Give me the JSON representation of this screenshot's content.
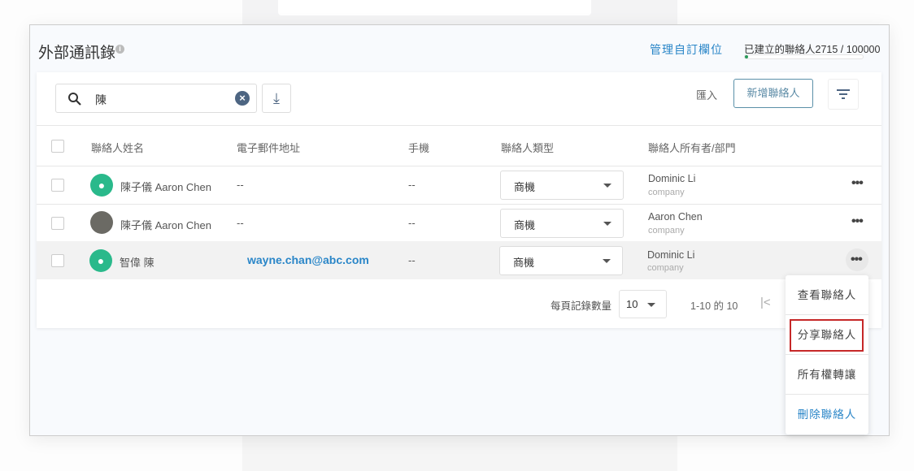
{
  "header": {
    "title": "外部通訊錄",
    "info_icon": "i",
    "manage_fields": "管理自訂欄位",
    "quota_label": "已建立的聯絡人2715 / 100000",
    "quota_fraction": 0.027
  },
  "toolbar": {
    "search_value": "陳",
    "clear": "×",
    "download": "⤓",
    "import": "匯入",
    "add_contact": "新增聯絡人"
  },
  "table": {
    "columns": [
      "聯絡人姓名",
      "電子郵件地址",
      "手機",
      "聯絡人類型",
      "聯絡人所有者/部門"
    ],
    "rows": [
      {
        "name": "陳子儀 Aaron Chen",
        "email": "--",
        "mobile": "--",
        "type": "商機",
        "owner": "Dominic Li",
        "dept": "company"
      },
      {
        "name": "陳子儀 Aaron Chen",
        "email": "--",
        "mobile": "--",
        "type": "商機",
        "owner": "Aaron Chen",
        "dept": "company"
      },
      {
        "name": "智偉 陳",
        "email": "wayne.chan@abc.com",
        "mobile": "--",
        "type": "商機",
        "owner": "Dominic Li",
        "dept": "company"
      }
    ]
  },
  "pagination": {
    "per_page_label": "每頁記錄數量",
    "per_page": "10",
    "range": "1-10 的 10",
    "first": "|<"
  },
  "menu": {
    "items": [
      "查看聯絡人",
      "分享聯絡人",
      "所有權轉讓",
      "刪除聯絡人"
    ]
  },
  "colors": {
    "accent": "#2a86c8",
    "avatar": "#2ab98b",
    "highlight": "#c62828"
  }
}
